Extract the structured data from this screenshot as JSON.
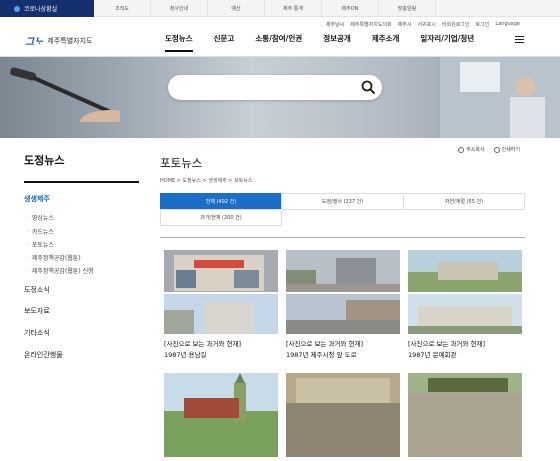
{
  "topbar": {
    "corona_label": "코로나상황실",
    "links": [
      "조직도",
      "청사안내",
      "예산",
      "제주 통계",
      "제주ON",
      "맞춤알림"
    ]
  },
  "utility": [
    "제주날씨",
    "제주특별자치도의회",
    "제주시",
    "서귀포시",
    "비회원로그인",
    "로그인",
    "Language"
  ],
  "header": {
    "logo_mark": "그ᄂᆞ",
    "logo_text": "제주특별자치도",
    "gnb": [
      "도정뉴스",
      "신문고",
      "소통/참여/인권",
      "정보공개",
      "제주소개",
      "일자리/기업/청년"
    ]
  },
  "search": {
    "placeholder": ""
  },
  "sidebar": {
    "title": "도정뉴스",
    "current": "생생제주",
    "sub_items": [
      "영상뉴스",
      "카드뉴스",
      "포토뉴스",
      "제주정책공감(웹툰)",
      "제주정책공감(웹툰) 신청"
    ],
    "menus": [
      "도정소식",
      "보도자료",
      "기타소식",
      "온라인간행물"
    ]
  },
  "tools": {
    "copy_url": "주소복사",
    "print": "인쇄하기"
  },
  "content": {
    "title": "포토뉴스",
    "breadcrumb": "HOME  >  도정뉴스  >  생생제주  >  포토뉴스",
    "tabs": [
      "전체 (492 건)",
      "도정/행사 (237 건)",
      "자연/계절 (55 건)",
      "과거/현재 (200 건)"
    ]
  },
  "cards": [
    {
      "line1": "[사진으로 보는 과거와 현재]",
      "line2": "1987년 용남길"
    },
    {
      "line1": "[사진으로 보는 과거와 현재]",
      "line2": "1987년 제주시청 앞 도로"
    },
    {
      "line1": "[사진으로 보는 과거와 현재]",
      "line2": "1987년 문예회관"
    }
  ],
  "colors": {
    "accent": "#1a6ec7",
    "navy": "#15306f",
    "sidebar_current": "#1a67c2"
  }
}
